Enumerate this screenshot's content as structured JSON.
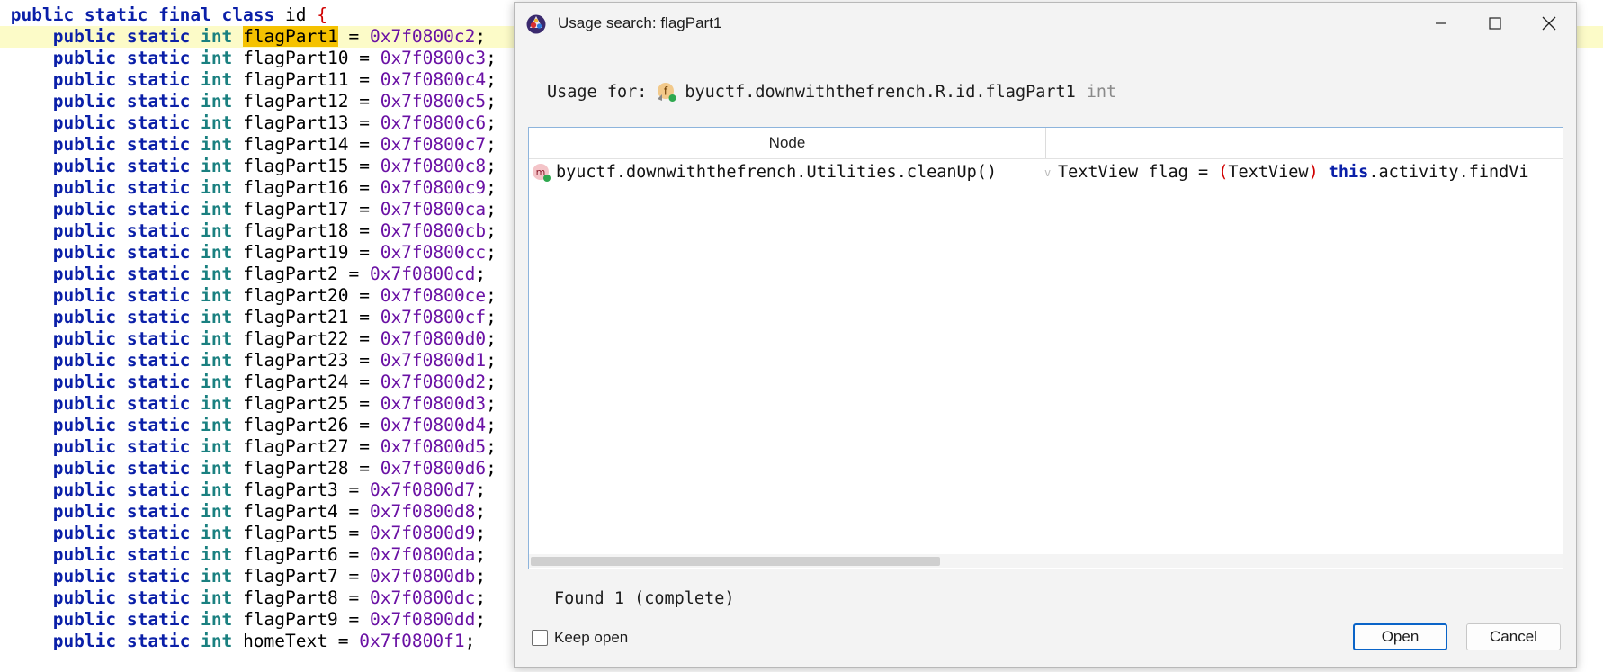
{
  "editor": {
    "class_decl": {
      "keywords": "public static final class",
      "name": "id",
      "brace": "{"
    },
    "field_modifiers": "public static",
    "field_type": "int",
    "fields": [
      {
        "name": "flagPart1",
        "value": "0x7f0800c2"
      },
      {
        "name": "flagPart10",
        "value": "0x7f0800c3"
      },
      {
        "name": "flagPart11",
        "value": "0x7f0800c4"
      },
      {
        "name": "flagPart12",
        "value": "0x7f0800c5"
      },
      {
        "name": "flagPart13",
        "value": "0x7f0800c6"
      },
      {
        "name": "flagPart14",
        "value": "0x7f0800c7"
      },
      {
        "name": "flagPart15",
        "value": "0x7f0800c8"
      },
      {
        "name": "flagPart16",
        "value": "0x7f0800c9"
      },
      {
        "name": "flagPart17",
        "value": "0x7f0800ca"
      },
      {
        "name": "flagPart18",
        "value": "0x7f0800cb"
      },
      {
        "name": "flagPart19",
        "value": "0x7f0800cc"
      },
      {
        "name": "flagPart2",
        "value": "0x7f0800cd"
      },
      {
        "name": "flagPart20",
        "value": "0x7f0800ce"
      },
      {
        "name": "flagPart21",
        "value": "0x7f0800cf"
      },
      {
        "name": "flagPart22",
        "value": "0x7f0800d0"
      },
      {
        "name": "flagPart23",
        "value": "0x7f0800d1"
      },
      {
        "name": "flagPart24",
        "value": "0x7f0800d2"
      },
      {
        "name": "flagPart25",
        "value": "0x7f0800d3"
      },
      {
        "name": "flagPart26",
        "value": "0x7f0800d4"
      },
      {
        "name": "flagPart27",
        "value": "0x7f0800d5"
      },
      {
        "name": "flagPart28",
        "value": "0x7f0800d6"
      },
      {
        "name": "flagPart3",
        "value": "0x7f0800d7"
      },
      {
        "name": "flagPart4",
        "value": "0x7f0800d8"
      },
      {
        "name": "flagPart5",
        "value": "0x7f0800d9"
      },
      {
        "name": "flagPart6",
        "value": "0x7f0800da"
      },
      {
        "name": "flagPart7",
        "value": "0x7f0800db"
      },
      {
        "name": "flagPart8",
        "value": "0x7f0800dc"
      },
      {
        "name": "flagPart9",
        "value": "0x7f0800dd"
      },
      {
        "name": "homeText",
        "value": "0x7f0800f1"
      }
    ],
    "highlighted_field": "flagPart1",
    "colors": {
      "keyword": "#0a1fa8",
      "type": "#1a8080",
      "number": "#6a11a4",
      "highlight": "#f5c200",
      "current_line": "#fcfbc8"
    }
  },
  "dialog": {
    "title": "Usage search: flagPart1",
    "icons": {
      "app": "jadx-logo-icon",
      "minimize": "minimize-icon",
      "maximize": "maximize-icon",
      "close": "close-icon"
    },
    "usage_label": "Usage for:",
    "usage_target": "byuctf.downwiththefrench.R.id.flagPart1",
    "usage_type": "int",
    "field_icon": "field-icon",
    "field_icon_letter": "f",
    "table": {
      "column_header": "Node",
      "rows": [
        {
          "icon": "method-icon",
          "icon_letter": "m",
          "node": "byuctf.downwiththefrench.Utilities.cleanUp()",
          "separator": "v",
          "code": {
            "type": "TextView",
            "variable": "flag",
            "equals": "=",
            "open_paren": "(",
            "cast": "TextView",
            "close_paren": ")",
            "keyword": "this",
            "rest": ".activity.findVi"
          }
        }
      ]
    },
    "found_text": "Found 1 (complete)",
    "keep_open_label": "Keep open",
    "keep_open_checked": false,
    "open_label": "Open",
    "cancel_label": "Cancel",
    "accent_color": "#0a64c8"
  }
}
